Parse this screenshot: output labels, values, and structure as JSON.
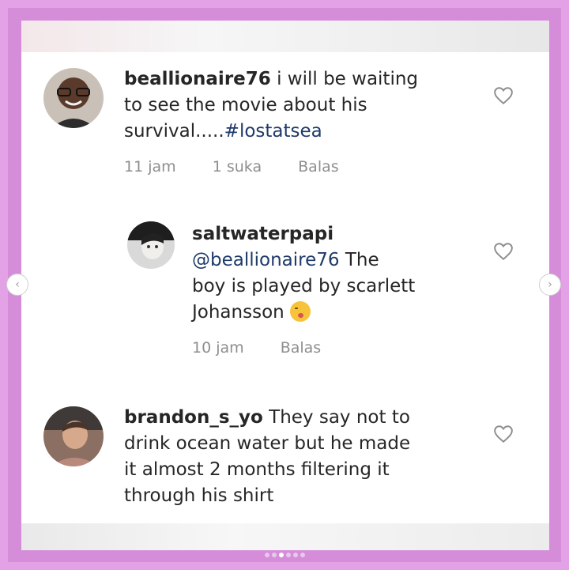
{
  "comments": [
    {
      "username": "beallionaire76",
      "lines": [
        "i will be waiting",
        "to see the movie about his",
        "survival.....",
        "#lostatsea"
      ],
      "time": "11 jam",
      "likes": "1 suka",
      "reply": "Balas"
    },
    {
      "username": "saltwaterpapi",
      "mention": "@beallionaire76",
      "lines": [
        "The",
        "boy is played by scarlett",
        "Johansson"
      ],
      "time": "10 jam",
      "reply": "Balas"
    },
    {
      "username": "brandon_s_yo",
      "lines": [
        "They say not to",
        "drink ocean water but he made",
        "it almost 2 months filtering it",
        "through his shirt"
      ]
    }
  ],
  "icons": {
    "heart": "heart-icon",
    "nav_prev": "chevron-left-icon",
    "nav_next": "chevron-right-icon",
    "emoji": "kissing-face-emoji"
  },
  "carousel": {
    "count": 6,
    "active_index": 2
  },
  "colors": {
    "frame": "#e4a2e6",
    "frame_inner": "#d58cd9",
    "text": "#262626",
    "link": "#1f3a6a",
    "meta": "#8e8e8e"
  }
}
